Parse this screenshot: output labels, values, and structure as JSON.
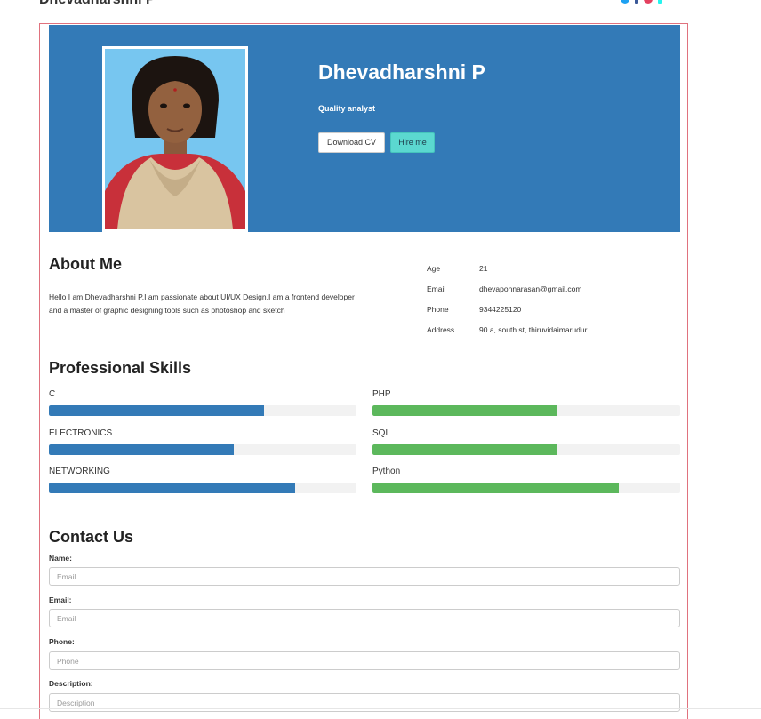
{
  "site": {
    "brand": "Dhevadharshni P"
  },
  "social": {
    "icons": [
      "twitter-icon",
      "facebook-icon",
      "instagram-icon",
      "tiktok-icon"
    ],
    "colors": [
      "#1da1f2",
      "#3b5998",
      "#e4405f",
      "#25f4ee"
    ]
  },
  "hero": {
    "name": "Dhevadharshni P",
    "role": "Quality analyst",
    "download_label": "Download CV",
    "hire_label": "Hire me",
    "bg_color": "#337ab7"
  },
  "about": {
    "heading": "About Me",
    "text": "Hello I am Dhevadharshni P.I am passionate about UI/UX Design.I am a frontend developer and a master of graphic designing tools such as photoshop and sketch",
    "info": [
      {
        "key": "Age",
        "value": "21"
      },
      {
        "key": "Email",
        "value": "dhevaponnarasan@gmail.com"
      },
      {
        "key": "Phone",
        "value": "9344225120"
      },
      {
        "key": "Address",
        "value": "90 a, south st, thiruvidaimarudur"
      }
    ]
  },
  "skills": {
    "heading": "Professional Skills",
    "items": [
      {
        "name": "C",
        "level": 0.7,
        "color": "#337ab7"
      },
      {
        "name": "PHP",
        "level": 0.6,
        "color": "#5cb85c"
      },
      {
        "name": "ELECTRONICS",
        "level": 0.6,
        "color": "#337ab7"
      },
      {
        "name": "SQL",
        "level": 0.6,
        "color": "#5cb85c"
      },
      {
        "name": "NETWORKING",
        "level": 0.8,
        "color": "#337ab7"
      },
      {
        "name": "Python",
        "level": 0.8,
        "color": "#5cb85c"
      }
    ]
  },
  "contact": {
    "heading": "Contact Us",
    "fields": [
      {
        "label": "Name:",
        "placeholder": "Email"
      },
      {
        "label": "Email:",
        "placeholder": "Email"
      },
      {
        "label": "Phone:",
        "placeholder": "Phone"
      },
      {
        "label": "Description:",
        "placeholder": "Description"
      }
    ]
  }
}
